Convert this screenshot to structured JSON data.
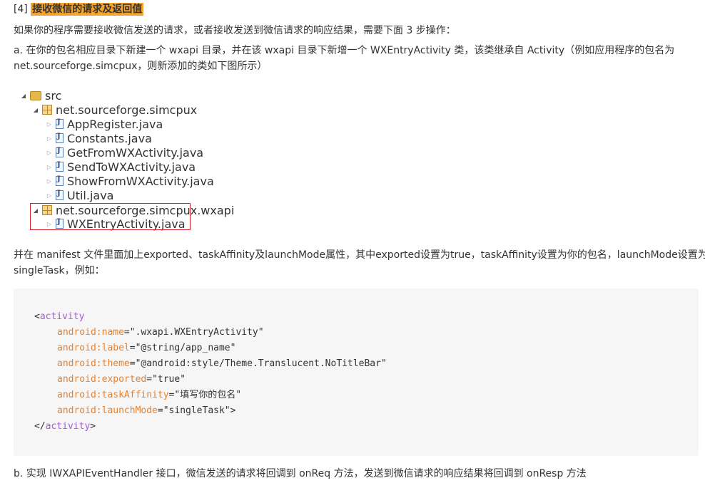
{
  "section": {
    "number": "[4]",
    "title": "接收微信的请求及返回值",
    "intro": "如果你的程序需要接收微信发送的请求，或者接收发送到微信请求的响应结果，需要下面 3 步操作：",
    "step_a_line1": "a. 在你的包名相应目录下新建一个 wxapi 目录，并在该 wxapi 目录下新增一个 WXEntryActivity 类，该类继承自 Activity（例如应用程序的包名为",
    "step_a_line2": "net.sourceforge.simcpux，则新添加的类如下图所示）"
  },
  "tree": {
    "root": "src",
    "package1": "net.sourceforge.simcpux",
    "files1": [
      "AppRegister.java",
      "Constants.java",
      "GetFromWXActivity.java",
      "SendToWXActivity.java",
      "ShowFromWXActivity.java",
      "Util.java"
    ],
    "package2": "net.sourceforge.simcpux.wxapi",
    "files2": [
      "WXEntryActivity.java"
    ],
    "highlight_color": "#d9222a"
  },
  "manifest_text": {
    "line1": "并在 manifest 文件里面加上exported、taskAffinity及launchMode属性，其中exported设置为true，taskAffinity设置为你的包名，launchMode设置为",
    "line2": "singleTask，例如："
  },
  "code": {
    "open_tag": "activity",
    "close_tag": "activity",
    "attributes": [
      {
        "name": "android:name",
        "value": "\".wxapi.WXEntryActivity\""
      },
      {
        "name": "android:label",
        "value": "\"@string/app_name\""
      },
      {
        "name": "android:theme",
        "value": "\"@android:style/Theme.Translucent.NoTitleBar\""
      },
      {
        "name": "android:exported",
        "value": "\"true\""
      },
      {
        "name": "android:taskAffinity",
        "value": "\"填写你的包名\""
      },
      {
        "name": "android:launchMode",
        "value": "\"singleTask\""
      }
    ],
    "colors": {
      "tag": "#a55bd3",
      "attr": "#e7812f",
      "background": "#f6f6f6"
    }
  },
  "step_b": "b. 实现 IWXAPIEventHandler 接口，微信发送的请求将回调到 onReq 方法，发送到微信请求的响应结果将回调到 onResp 方法"
}
